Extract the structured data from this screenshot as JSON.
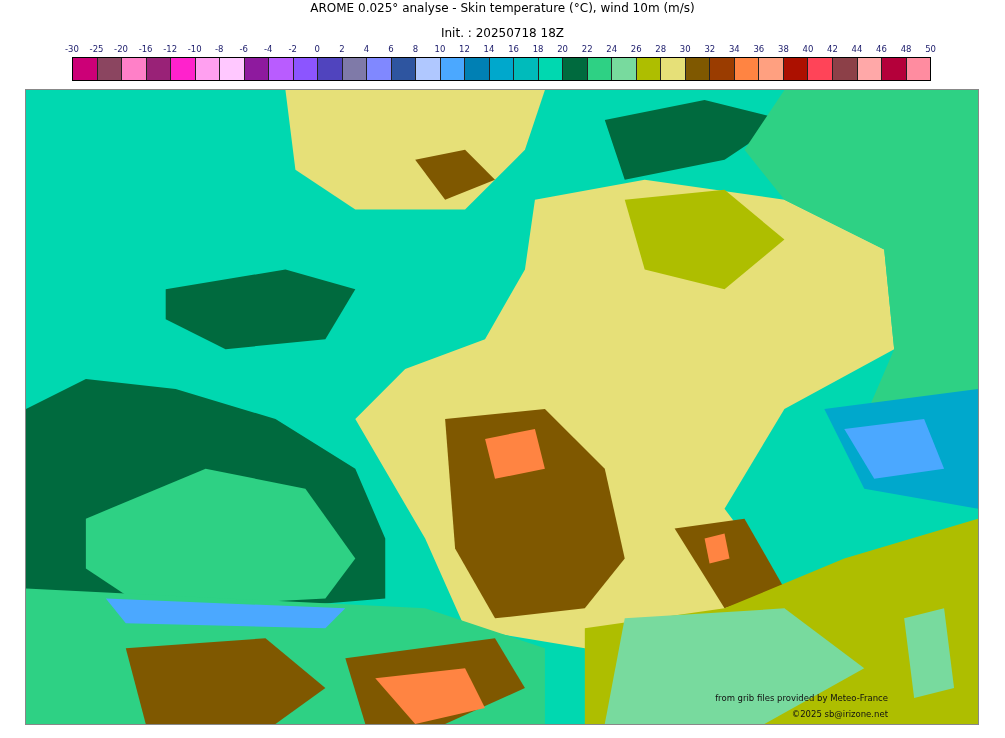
{
  "title": "AROME 0.025° analyse - Skin temperature (°C), wind 10m (m/s)",
  "subtitle": "Init. : 20250718 18Z",
  "colorbar": {
    "ticks": [
      "-30",
      "-25",
      "-20",
      "-16",
      "-12",
      "-10",
      "-8",
      "-6",
      "-4",
      "-2",
      "0",
      "2",
      "4",
      "6",
      "8",
      "10",
      "12",
      "14",
      "16",
      "18",
      "20",
      "22",
      "24",
      "26",
      "28",
      "30",
      "32",
      "34",
      "36",
      "38",
      "40",
      "42",
      "44",
      "46",
      "48",
      "50"
    ],
    "bins": [
      {
        "color": "#cc0077"
      },
      {
        "color": "#8b4560"
      },
      {
        "color": "#ff80c8"
      },
      {
        "color": "#992277"
      },
      {
        "color": "#ff22cc"
      },
      {
        "color": "#ffa0f0"
      },
      {
        "color": "#ffc8ff"
      },
      {
        "color": "#8e1a9e"
      },
      {
        "color": "#b95cff"
      },
      {
        "color": "#8c55ff"
      },
      {
        "color": "#5044be"
      },
      {
        "color": "#7f7aa8"
      },
      {
        "color": "#8088ff"
      },
      {
        "color": "#2e55a0"
      },
      {
        "color": "#b0c8ff"
      },
      {
        "color": "#4ba8ff"
      },
      {
        "color": "#0080b4"
      },
      {
        "color": "#00a8cc"
      },
      {
        "color": "#00bbbb"
      },
      {
        "color": "#00d8b0"
      },
      {
        "color": "#006a3e"
      },
      {
        "color": "#2ed184"
      },
      {
        "color": "#78da9e"
      },
      {
        "color": "#aebe00"
      },
      {
        "color": "#e6e078"
      },
      {
        "color": "#7f5800"
      },
      {
        "color": "#9a3c00"
      },
      {
        "color": "#ff8442"
      },
      {
        "color": "#ffa080"
      },
      {
        "color": "#ac1000"
      },
      {
        "color": "#ff4458"
      },
      {
        "color": "#8c4048"
      },
      {
        "color": "#ffa8a8"
      },
      {
        "color": "#b4003a"
      },
      {
        "color": "#ff8ca0"
      }
    ]
  },
  "credits": [
    "from grib files provided by Meteo-France",
    "©2025 sb@irizone.net"
  ]
}
